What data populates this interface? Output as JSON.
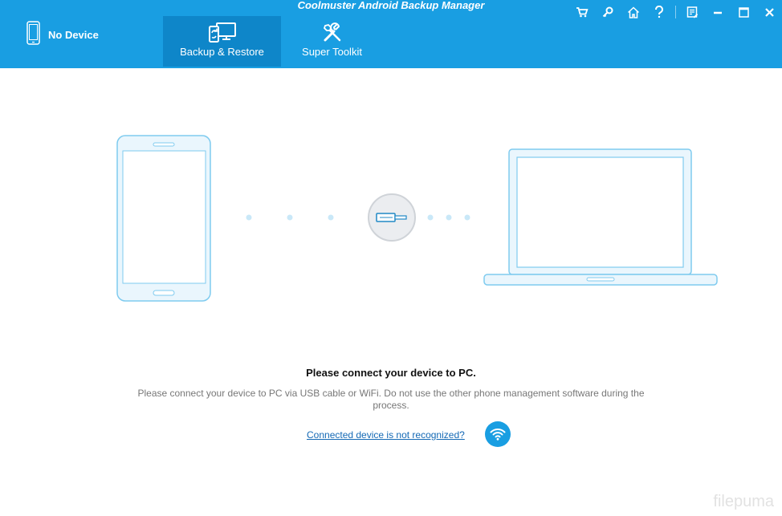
{
  "window": {
    "title": "Coolmuster Android Backup Manager"
  },
  "device": {
    "status_label": "No Device"
  },
  "tabs": [
    {
      "label": "Backup & Restore",
      "icon": "backup-restore-icon",
      "active": true
    },
    {
      "label": "Super Toolkit",
      "icon": "tools-icon",
      "active": false
    }
  ],
  "window_controls": [
    "cart-icon",
    "key-icon",
    "home-icon",
    "help-icon",
    "feedback-icon",
    "minimize-icon",
    "maximize-icon",
    "close-icon"
  ],
  "connect": {
    "title": "Please connect your device to PC.",
    "description": "Please connect your device to PC via USB cable or WiFi. Do not use the other phone management software during the process.",
    "help_link": "Connected device is not recognized?"
  },
  "watermark": "filepuma",
  "colors": {
    "header": "#199ee2",
    "active_tab": "#0e86c9",
    "illustration_stroke": "#7fcbef",
    "illustration_fill": "#eaf6fd",
    "link": "#1469b5"
  }
}
